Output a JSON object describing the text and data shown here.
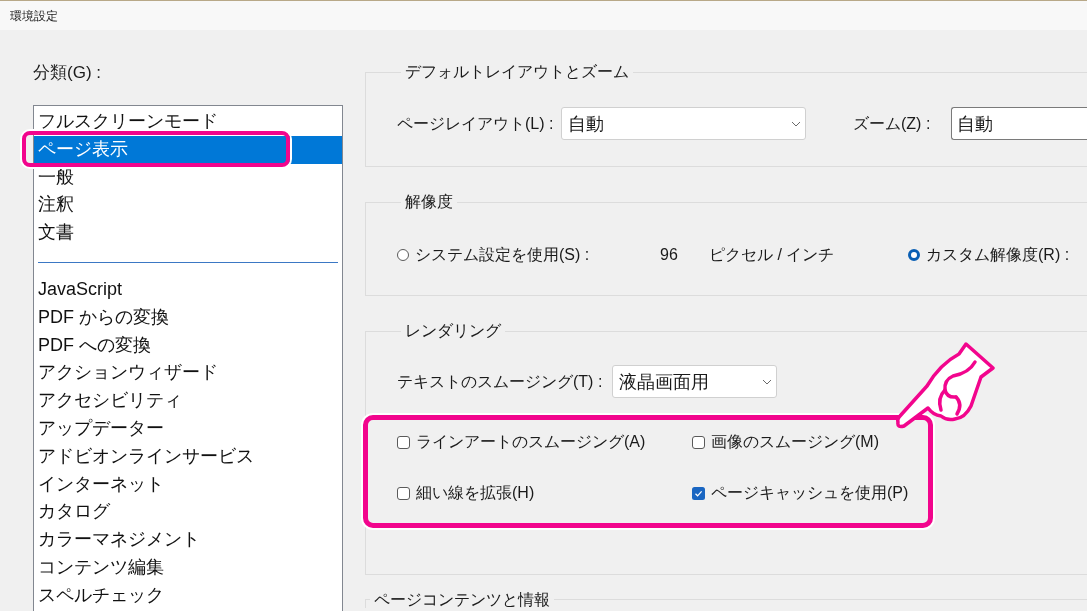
{
  "window": {
    "title": "環境設定"
  },
  "categories": {
    "label": "分類(G) :",
    "sections": [
      {
        "items": [
          {
            "label": "フルスクリーンモード",
            "selected": false
          },
          {
            "label": "ページ表示",
            "selected": true
          },
          {
            "label": "一般",
            "selected": false
          },
          {
            "label": "注釈",
            "selected": false
          },
          {
            "label": "文書",
            "selected": false
          }
        ]
      },
      {
        "items": [
          {
            "label": "JavaScript",
            "selected": false
          },
          {
            "label": "PDF からの変換",
            "selected": false
          },
          {
            "label": "PDF への変換",
            "selected": false
          },
          {
            "label": "アクションウィザード",
            "selected": false
          },
          {
            "label": "アクセシビリティ",
            "selected": false
          },
          {
            "label": "アップデーター",
            "selected": false
          },
          {
            "label": "アドビオンラインサービス",
            "selected": false
          },
          {
            "label": "インターネット",
            "selected": false
          },
          {
            "label": "カタログ",
            "selected": false
          },
          {
            "label": "カラーマネジメント",
            "selected": false
          },
          {
            "label": "コンテンツ編集",
            "selected": false
          },
          {
            "label": "スペルチェック",
            "selected": false
          }
        ]
      }
    ]
  },
  "default_layout_zoom": {
    "title": "デフォルトレイアウトとズーム",
    "page_layout": {
      "label": "ページレイアウト(L) :",
      "value": "自動"
    },
    "zoom": {
      "label": "ズーム(Z) :",
      "value": "自動"
    }
  },
  "resolution": {
    "title": "解像度",
    "system": {
      "label": "システム設定を使用(S) :",
      "selected": false,
      "value": "96",
      "unit": "ピクセル / インチ"
    },
    "custom": {
      "label": "カスタム解像度(R) :",
      "selected": true
    }
  },
  "rendering": {
    "title": "レンダリング",
    "text_smoothing": {
      "label": "テキストのスムージング(T) :",
      "value": "液晶画面用"
    },
    "options": [
      {
        "label": "ラインアートのスムージング(A)",
        "checked": false
      },
      {
        "label": "画像のスムージング(M)",
        "checked": false
      },
      {
        "label": "細い線を拡張(H)",
        "checked": false
      },
      {
        "label": "ページキャッシュを使用(P)",
        "checked": true
      }
    ]
  },
  "page_content": {
    "title": "ページコンテンツと情報"
  }
}
